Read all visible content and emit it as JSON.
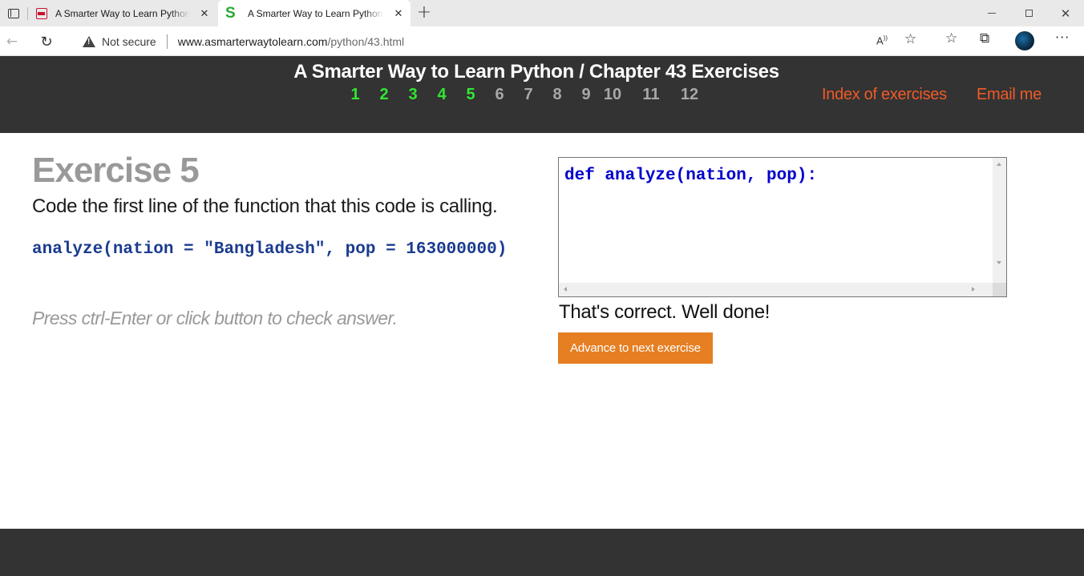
{
  "browser": {
    "tabs": [
      {
        "title": "A Smarter Way to Learn Python - ",
        "favicon": "pdf-icon"
      },
      {
        "title": "A Smarter Way to Learn Python - ",
        "favicon": "s-logo-icon",
        "active": true
      }
    ],
    "address": {
      "security_label": "Not secure",
      "url_host": "www.asmarterwaytolearn.com",
      "url_path": "/python/43.html"
    }
  },
  "header": {
    "title": "A Smarter Way to Learn Python / Chapter 43 Exercises",
    "exercise_numbers": [
      {
        "label": "1",
        "status": "done"
      },
      {
        "label": "2",
        "status": "done"
      },
      {
        "label": "3",
        "status": "done"
      },
      {
        "label": "4",
        "status": "done"
      },
      {
        "label": "5",
        "status": "done"
      },
      {
        "label": "6",
        "status": "todo"
      },
      {
        "label": "7",
        "status": "todo"
      },
      {
        "label": "8",
        "status": "todo"
      },
      {
        "label": "9",
        "status": "todo"
      },
      {
        "label": "10",
        "status": "todo"
      },
      {
        "label": "11",
        "status": "todo"
      },
      {
        "label": "12",
        "status": "todo"
      }
    ],
    "links": {
      "index": "Index of exercises",
      "email": "Email me"
    }
  },
  "exercise": {
    "heading": "Exercise 5",
    "instruction": "Code the first line of the function that this code is calling.",
    "code": "analyze(nation = \"Bangladesh\", pop = 163000000)",
    "hint": "Press ctrl-Enter or click button to check answer."
  },
  "answer": {
    "editor_value": "def analyze(nation, pop):",
    "feedback": "That's correct. Well done!",
    "advance_label": "Advance to next exercise"
  },
  "colors": {
    "header_bg": "#333333",
    "done_number": "#33e633",
    "todo_number": "#a8a8a8",
    "link": "#f05a28",
    "code": "#1b3b8f",
    "editor_code": "#0000cc",
    "button": "#e67e22"
  }
}
